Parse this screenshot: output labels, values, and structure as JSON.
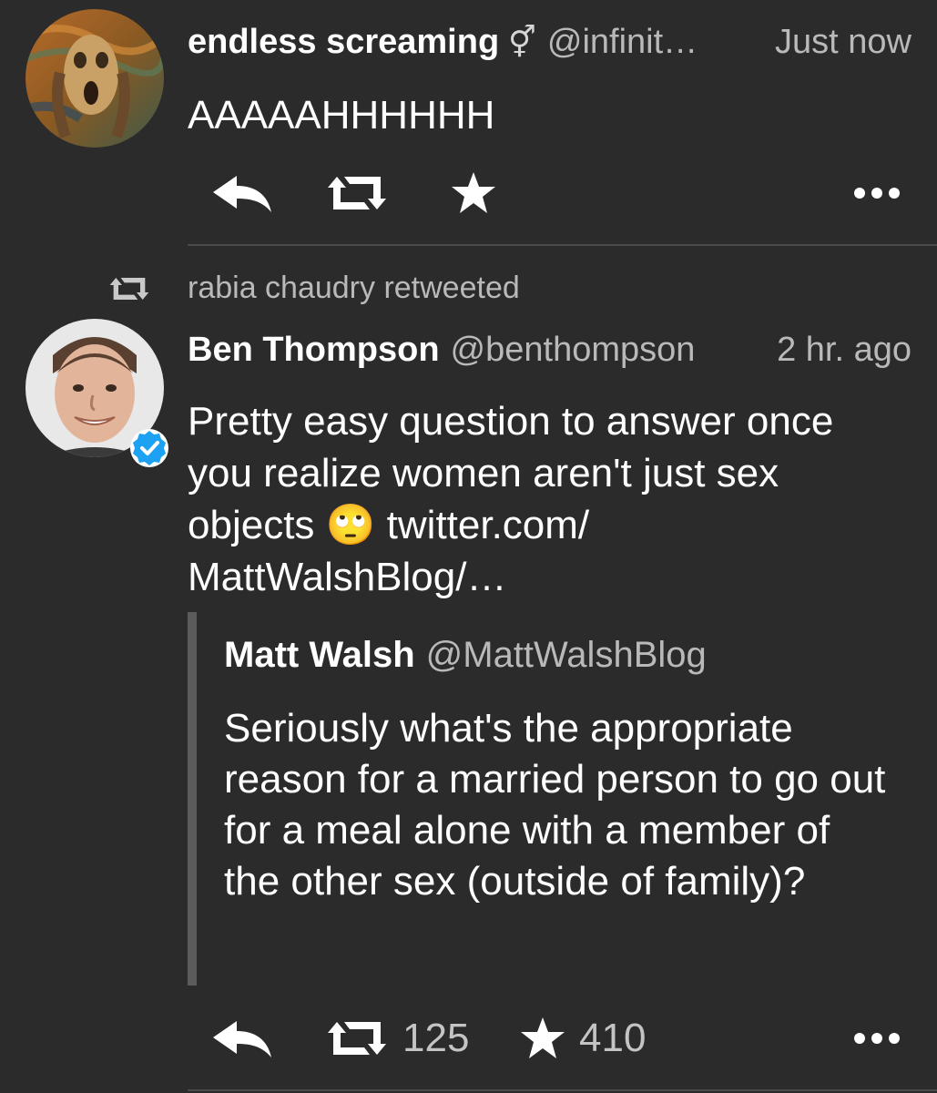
{
  "tweets": [
    {
      "name": "endless screaming",
      "name_symbol": "⚥",
      "handle": "@infinit…",
      "time": "Just now",
      "text": "AAAAAHHHHHH"
    },
    {
      "retweeted_by": "rabia chaudry retweeted",
      "name": "Ben Thompson",
      "handle": "@benthompson",
      "time": "2 hr. ago",
      "verified": true,
      "text_parts": [
        "Pretty easy question to answer once you realize women aren't just sex objects ",
        "🙄",
        " twitter.com/ MattWalshBlog/…"
      ],
      "quoted": {
        "name": "Matt Walsh",
        "handle": "@MattWalshBlog",
        "text": "Seriously what's the appropriate reason for a married person to go out for a meal alone with a member of the other sex (outside of family)?"
      },
      "retweet_count": "125",
      "favorite_count": "410"
    }
  ],
  "icons": {
    "reply": "reply-icon",
    "retweet": "retweet-icon",
    "favorite": "star-icon",
    "more": "more-icon",
    "verified": "verified-badge-icon"
  },
  "colors": {
    "background": "#2b2b2b",
    "verified": "#1da1f2",
    "secondary_text": "#b9b9b9"
  }
}
